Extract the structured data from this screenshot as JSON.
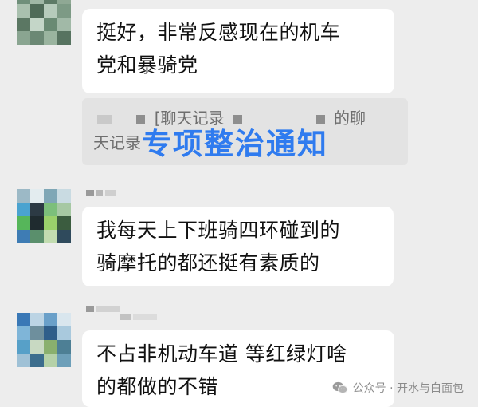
{
  "messages": [
    {
      "lines": [
        "挺好，非常反感现在的机车",
        "党和暴骑党"
      ]
    },
    {
      "lines": [
        "我每天上下班骑四环碰到的",
        "骑摩托的都还挺有素质的"
      ]
    },
    {
      "lines": [
        "不占非机动车道 等红绿灯啥",
        "的都做的不错"
      ]
    }
  ],
  "quote": {
    "part1": "[聊天记录",
    "part2": "的聊",
    "part3": "天记录"
  },
  "overlay_title": "专项整治通知",
  "watermark": {
    "icon": "wechat-icon",
    "text": "公众号 · 开水与白面包"
  },
  "colors": {
    "background": "#ededed",
    "bubble": "#ffffff",
    "quote_bg": "#e3e3e3",
    "overlay_title": "#2f7bef"
  }
}
